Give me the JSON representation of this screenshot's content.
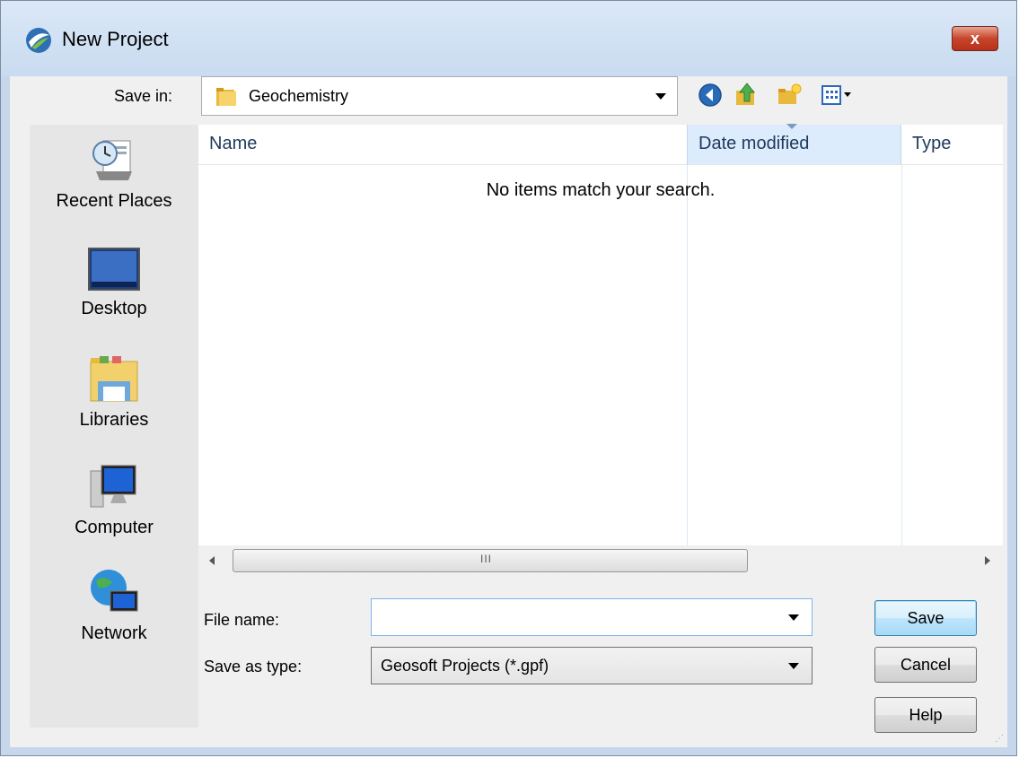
{
  "window": {
    "title": "New Project",
    "close_label": "x"
  },
  "toolbar": {
    "save_in_label": "Save in:",
    "save_in_value": "Geochemistry",
    "buttons": [
      {
        "icon": "back-icon"
      },
      {
        "icon": "up-folder-icon"
      },
      {
        "icon": "new-folder-icon"
      },
      {
        "icon": "view-menu-icon"
      }
    ]
  },
  "places": [
    {
      "label": "Recent Places",
      "icon": "recent-places-icon"
    },
    {
      "label": "Desktop",
      "icon": "desktop-icon"
    },
    {
      "label": "Libraries",
      "icon": "libraries-icon"
    },
    {
      "label": "Computer",
      "icon": "computer-icon"
    },
    {
      "label": "Network",
      "icon": "network-icon"
    }
  ],
  "file_list": {
    "columns": [
      "Name",
      "Date modified",
      "Type"
    ],
    "empty_message": "No items match your search.",
    "scroll_grip": "III"
  },
  "form": {
    "file_name_label": "File name:",
    "file_name_value": "",
    "save_as_type_label": "Save as type:",
    "save_as_type_value": "Geosoft Projects (*.gpf)"
  },
  "buttons": {
    "save": "Save",
    "cancel": "Cancel",
    "help": "Help"
  },
  "colors": {
    "titlebar": "#c9dbf0",
    "close_button": "#c7452a",
    "selected_column": "#dcecfc"
  }
}
